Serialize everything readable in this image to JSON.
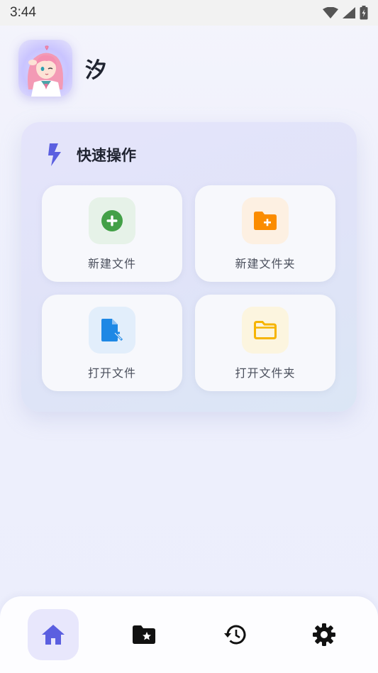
{
  "status": {
    "time": "3:44"
  },
  "profile": {
    "name": "汐"
  },
  "quick_actions": {
    "title": "快速操作",
    "items": [
      {
        "label": "新建文件",
        "icon": "add-circle-icon",
        "color": "#43a047",
        "bg": "#e6f2e8"
      },
      {
        "label": "新建文件夹",
        "icon": "folder-add-icon",
        "color": "#fb8c00",
        "bg": "#fdf0e2"
      },
      {
        "label": "打开文件",
        "icon": "file-open-icon",
        "color": "#1e88e5",
        "bg": "#e2eefb"
      },
      {
        "label": "打开文件夹",
        "icon": "folder-open-icon",
        "color": "#f6b400",
        "bg": "#fcf5df"
      }
    ]
  },
  "nav": {
    "items": [
      {
        "name": "home",
        "icon": "home-icon",
        "active": true
      },
      {
        "name": "favorites",
        "icon": "folder-star-icon",
        "active": false
      },
      {
        "name": "history",
        "icon": "history-icon",
        "active": false
      },
      {
        "name": "settings",
        "icon": "gear-icon",
        "active": false
      }
    ],
    "accent": "#5b5fe0"
  }
}
